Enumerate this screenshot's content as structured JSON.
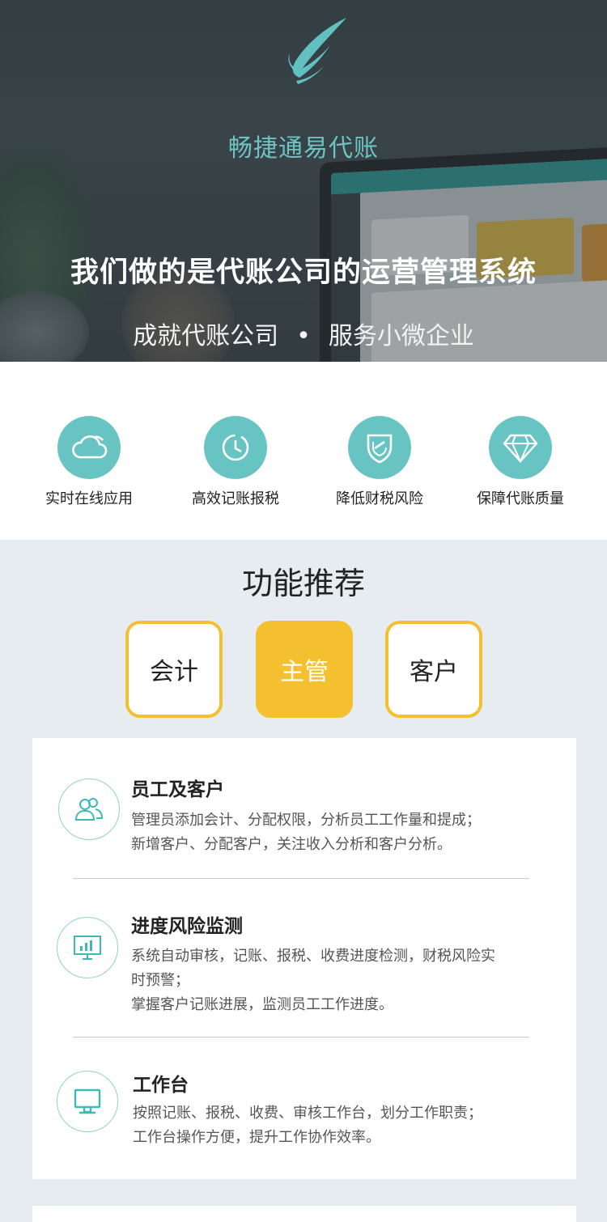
{
  "hero": {
    "brand_name": "畅捷通易代账",
    "headline": "我们做的是代账公司的运营管理系统",
    "subline_left": "成就代账公司",
    "subline_dot": "•",
    "subline_right": "服务小微企业",
    "logo_icon": "wing-logo-icon",
    "accent_color": "#6cc3c2"
  },
  "features": [
    {
      "label": "实时在线应用",
      "icon": "cloud-icon"
    },
    {
      "label": "高效记账报税",
      "icon": "clock-icon"
    },
    {
      "label": "降低财税风险",
      "icon": "shield-icon"
    },
    {
      "label": "保障代账质量",
      "icon": "diamond-icon"
    }
  ],
  "recommend": {
    "title": "功能推荐",
    "tabs": [
      {
        "label": "会计",
        "active": false
      },
      {
        "label": "主管",
        "active": true
      },
      {
        "label": "客户",
        "active": false
      }
    ],
    "tab_color": "#f4c030",
    "items": [
      {
        "title": "员工及客户",
        "icon": "users-icon",
        "lines": [
          "管理员添加会计、分配权限，分析员工工作量和提成；",
          "新增客户、分配客户，关注收入分析和客户分析。"
        ]
      },
      {
        "title": "进度风险监测",
        "icon": "monitor-chart-icon",
        "lines": [
          "系统自动审核，记账、报税、收费进度检测，财税风险实",
          "时预警；",
          "掌握客户记账进展，监测员工工作进度。"
        ]
      },
      {
        "title": "工作台",
        "icon": "desktop-icon",
        "lines": [
          "按照记账、报税、收费、审核工作台，划分工作职责；",
          "工作台操作方便，提升工作协作效率。"
        ]
      }
    ]
  }
}
